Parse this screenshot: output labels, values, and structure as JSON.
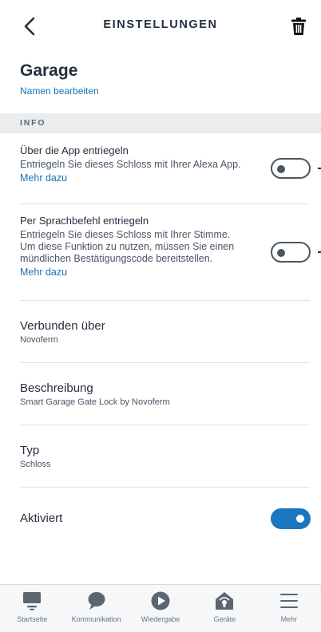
{
  "header": {
    "title": "EINSTELLUNGEN"
  },
  "device": {
    "name": "Garage",
    "edit_link": "Namen bearbeiten"
  },
  "section": {
    "title": "INFO"
  },
  "rows": {
    "app_unlock": {
      "title": "Über die App entriegeln",
      "desc": "Entriegeln Sie dieses Schloss mit Ihrer Alexa App.",
      "link": "Mehr dazu",
      "toggle_on": false
    },
    "voice_unlock": {
      "title": "Per Sprachbefehl entriegeln",
      "desc_lines": [
        "Entriegeln Sie dieses Schloss mit Ihrer Stimme.",
        "Um diese Funktion zu nutzen, müssen Sie einen",
        "mündlichen Bestätigungscode bereitstellen."
      ],
      "link": "Mehr dazu",
      "toggle_on": false
    },
    "connected_via": {
      "title": "Verbunden über",
      "value": "Novoferm"
    },
    "description": {
      "title": "Beschreibung",
      "value": "Smart Garage Gate Lock by Novoferm"
    },
    "type": {
      "title": "Typ",
      "value": "Schloss"
    },
    "enabled": {
      "title": "Aktiviert",
      "toggle_on": true
    }
  },
  "nav": {
    "items": [
      {
        "label": "Startseite",
        "icon": "home-icon"
      },
      {
        "label": "Kommunikation",
        "icon": "chat-bubble-icon"
      },
      {
        "label": "Wiedergabe",
        "icon": "play-icon"
      },
      {
        "label": "Geräte",
        "icon": "smart-home-icon"
      },
      {
        "label": "Mehr",
        "icon": "menu-icon"
      }
    ]
  },
  "colors": {
    "accent": "#1b76be",
    "link": "#1a73b5",
    "text": "#232f3e",
    "section_bg": "#eaeced"
  }
}
